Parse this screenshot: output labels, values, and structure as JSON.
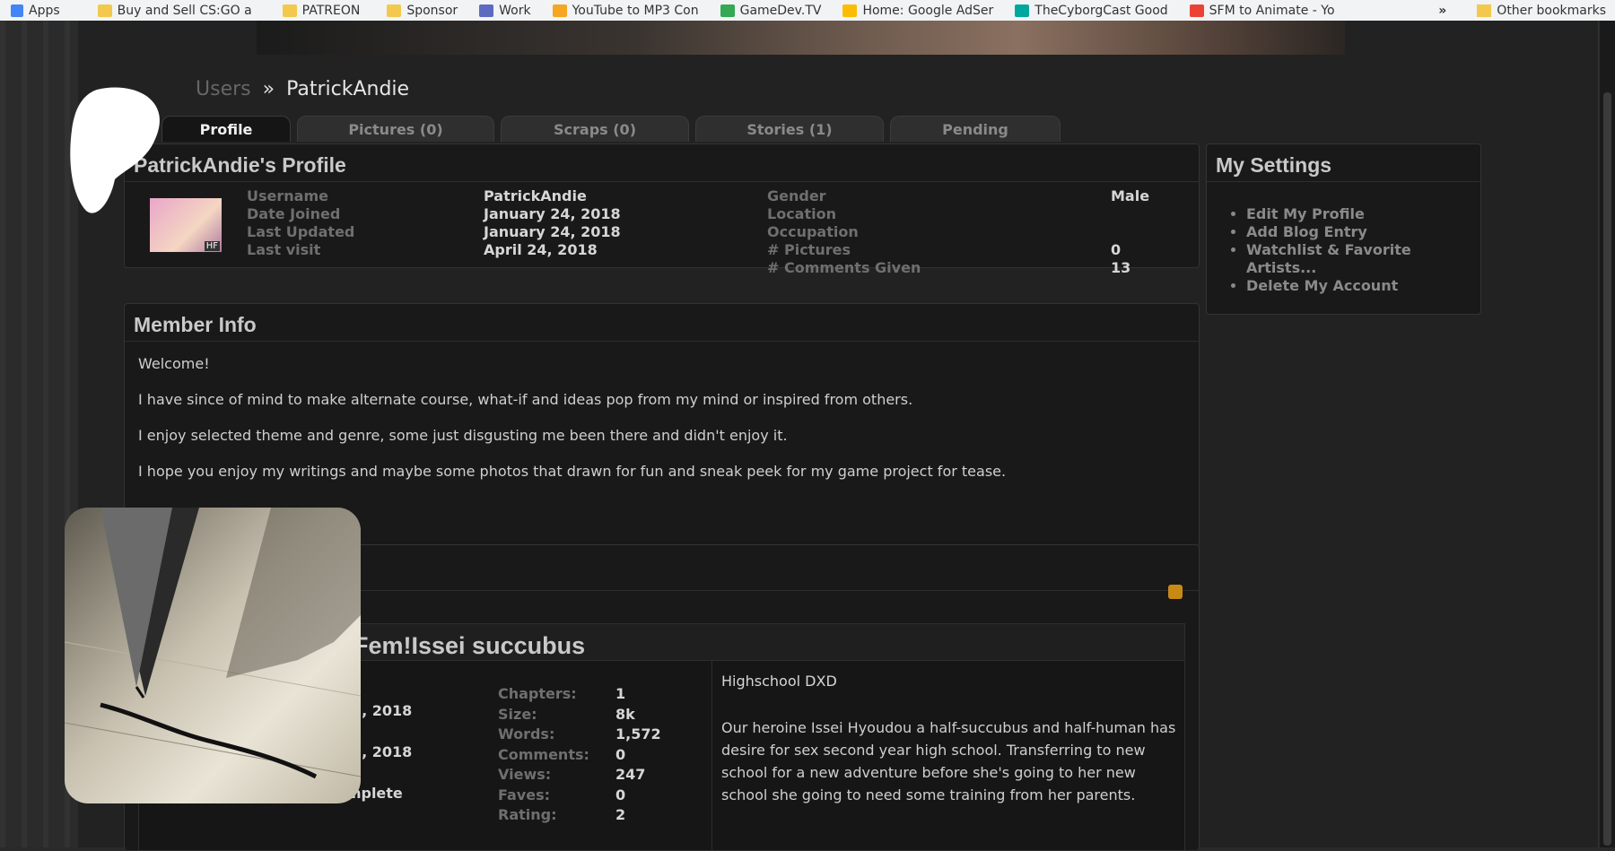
{
  "bookmarks": {
    "items": [
      {
        "label": "Apps",
        "color": "#4285f4"
      },
      {
        "label": "Buy and Sell CS:GO a",
        "color": "#f2c94c"
      },
      {
        "label": "PATREON",
        "color": "#f2c94c"
      },
      {
        "label": "Sponsor",
        "color": "#f2c94c"
      },
      {
        "label": "Work",
        "color": "#5c6bc0"
      },
      {
        "label": "YouTube to MP3 Con",
        "color": "#f5a623"
      },
      {
        "label": "GameDev.TV",
        "color": "#34a853"
      },
      {
        "label": "Home: Google AdSer",
        "color": "#fbbc04"
      },
      {
        "label": "TheCyborgCast Good",
        "color": "#00a79d"
      },
      {
        "label": "SFM to Animate - Yo",
        "color": "#ea4335"
      }
    ],
    "more": "»",
    "other": "Other bookmarks"
  },
  "breadcrumb": {
    "users": "Users",
    "sep": "»",
    "current": "PatrickAndie"
  },
  "tabs": [
    "Profile",
    "Pictures (0)",
    "Scraps (0)",
    "Stories (1)",
    "Pending"
  ],
  "profile": {
    "title": "PatrickAndie's Profile",
    "left": [
      {
        "label": "Username",
        "value": "PatrickAndie"
      },
      {
        "label": "Date Joined",
        "value": "January 24, 2018"
      },
      {
        "label": "Last Updated",
        "value": "January 24, 2018"
      },
      {
        "label": "Last visit",
        "value": "April 24, 2018"
      }
    ],
    "right": [
      {
        "label": "Gender",
        "value": "Male"
      },
      {
        "label": "Location",
        "value": ""
      },
      {
        "label": "Occupation",
        "value": ""
      },
      {
        "label": "# Pictures",
        "value": "0"
      },
      {
        "label": "# Comments Given",
        "value": "13"
      }
    ],
    "avatar_badge": "HF"
  },
  "settings": {
    "title": "My Settings",
    "items": [
      "Edit My Profile",
      "Add Blog Entry",
      "Watchlist & Favorite",
      "Artists...",
      "Delete My Account"
    ]
  },
  "member_info": {
    "title": "Member Info",
    "paragraphs": [
      "Welcome!",
      "I have since of mind to make alternate course, what-if and ideas pop from my mind or inspired from others.",
      "I enjoy selected theme and genre, some just disgusting me been there and didn't enjoy it.",
      "I hope you enjoy my writings and maybe some photos that drawn for fun and sneak peek for my game project for tease."
    ]
  },
  "story": {
    "title": "Fem!Issei succubus",
    "dates": [
      "3, 2018",
      "3, 2018"
    ],
    "status": "Incomplete",
    "stats": [
      {
        "label": "Chapters:",
        "value": "1"
      },
      {
        "label": "Size:",
        "value": "8k"
      },
      {
        "label": "Words:",
        "value": "1,572"
      },
      {
        "label": "Comments:",
        "value": "0"
      },
      {
        "label": "Views:",
        "value": "247"
      },
      {
        "label": "Faves:",
        "value": "0"
      },
      {
        "label": "Rating:",
        "value": "2"
      }
    ],
    "category": "Highschool DXD",
    "description": "Our heroine Issei Hyoudou a half-succubus and half-human has desire for sex second year high school. Transferring to new school for a new adventure before she's going to her new school she going to need some training from her parents."
  }
}
